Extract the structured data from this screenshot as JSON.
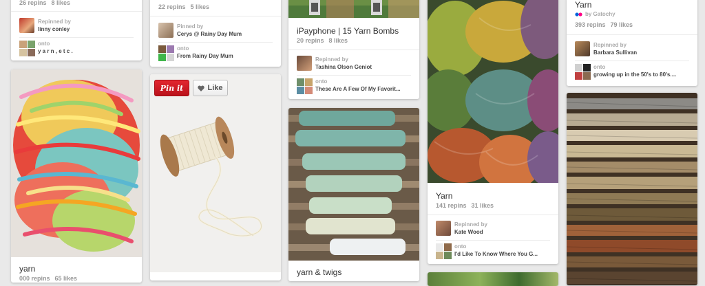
{
  "pins": [
    {
      "stats": [
        "26 repins",
        "8 likes"
      ],
      "repin_label": "Repinned by",
      "user": "linny conley",
      "onto_label": "onto",
      "board": "y a r n , e t c ."
    },
    {
      "stats": [
        "22 repins",
        "5 likes"
      ],
      "repin_label": "Pinned by",
      "user": "Cerys @ Rainy Day Mum",
      "onto_label": "onto",
      "board": "From Rainy Day Mum"
    },
    {
      "title": "iPayphone | 15 Yarn Bombs",
      "stats": [
        "20 repins",
        "8 likes"
      ],
      "repin_label": "Repinned by",
      "user": "Tashina Olson Geniot",
      "onto_label": "onto",
      "board": "These Are A Few Of My Favorit..."
    },
    {
      "title": "Yarn",
      "stats": [
        "141 repins",
        "31 likes"
      ],
      "repin_label": "Repinned by",
      "user": "Kate Wood",
      "onto_label": "onto",
      "board": "I'd Like To Know Where You G..."
    },
    {
      "title": "Yarn",
      "via": "by Gatochy",
      "stats": [
        "393 repins",
        "79 likes"
      ],
      "repin_label": "Repinned by",
      "user": "Barbara Sullivan",
      "onto_label": "onto",
      "board": "growing up in the 50's to 80's...."
    },
    {
      "title": "yarn",
      "stats": [
        "000 repins",
        "65 likes"
      ]
    },
    {
      "title": "yarn & twigs"
    }
  ],
  "actions": {
    "pin_it": "Pin it",
    "like": "Like"
  },
  "icons": {
    "heart": "heart-icon",
    "via": "flickr-dots-icon"
  },
  "colors": {
    "background": "#e9e9e9",
    "pin_it": "#cb2027"
  }
}
